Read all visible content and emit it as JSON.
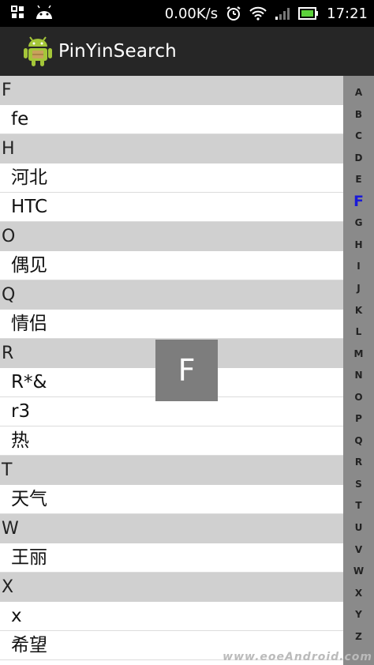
{
  "status_bar": {
    "net_speed": "0.00K/s",
    "time": "17:21",
    "icons": [
      "grid-icon",
      "android-icon",
      "alarm-icon",
      "wifi-icon",
      "signal-icon",
      "battery-icon"
    ]
  },
  "action_bar": {
    "title": "PinYinSearch",
    "icon": "android-app-icon"
  },
  "list": [
    {
      "header": "F",
      "items": [
        "fe"
      ]
    },
    {
      "header": "H",
      "items": [
        "河北",
        "HTC"
      ]
    },
    {
      "header": "O",
      "items": [
        "偶见"
      ]
    },
    {
      "header": "Q",
      "items": [
        "情侣"
      ]
    },
    {
      "header": "R",
      "items": [
        "R*&",
        "r3",
        "热"
      ]
    },
    {
      "header": "T",
      "items": [
        "天气"
      ]
    },
    {
      "header": "W",
      "items": [
        "王丽"
      ]
    },
    {
      "header": "X",
      "items": [
        "x",
        "希望"
      ]
    }
  ],
  "index_bar": {
    "letters": [
      "A",
      "B",
      "C",
      "D",
      "E",
      "F",
      "G",
      "H",
      "I",
      "J",
      "K",
      "L",
      "M",
      "N",
      "O",
      "P",
      "Q",
      "R",
      "S",
      "T",
      "U",
      "V",
      "W",
      "X",
      "Y",
      "Z"
    ],
    "active": "F"
  },
  "overlay": {
    "letter": "F"
  },
  "watermark": "www.eoeAndroid.com",
  "colors": {
    "status_bar_bg": "#000000",
    "action_bar_bg": "#262626",
    "header_bg": "#d0d0d0",
    "index_bar_bg": "#8a8a8a",
    "active_letter": "#1a1ad8",
    "overlay_bg": "#7d7d7d"
  }
}
